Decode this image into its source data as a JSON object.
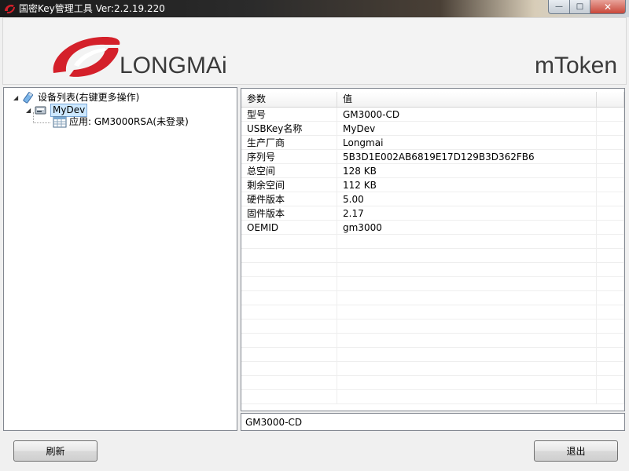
{
  "window": {
    "title": "国密Key管理工具  Ver:2.2.19.220",
    "controls": {
      "minimize": "—",
      "maximize": "□",
      "close": "✕"
    }
  },
  "banner": {
    "brand_logo_text": "LONGMAi",
    "product_logo_text": "mToken",
    "brand_color": "#d4202a"
  },
  "tree": {
    "root_label": "设备列表(右键更多操作)",
    "device_label": "MyDev",
    "app_label": "应用: GM3000RSA(未登录)"
  },
  "table": {
    "headers": [
      "参数",
      "值"
    ],
    "rows": [
      [
        "型号",
        "GM3000-CD"
      ],
      [
        "USBKey名称",
        "MyDev"
      ],
      [
        "生产厂商",
        "Longmai"
      ],
      [
        "序列号",
        "5B3D1E002AB6819E17D129B3D362FB6"
      ],
      [
        "总空间",
        "128 KB"
      ],
      [
        "剩余空间",
        "112 KB"
      ],
      [
        "硬件版本",
        "5.00"
      ],
      [
        "固件版本",
        "2.17"
      ],
      [
        "OEMID",
        "gm3000"
      ]
    ],
    "empty_rows": 12
  },
  "status": {
    "value": "GM3000-CD"
  },
  "buttons": {
    "refresh": "刷新",
    "exit": "退出"
  }
}
